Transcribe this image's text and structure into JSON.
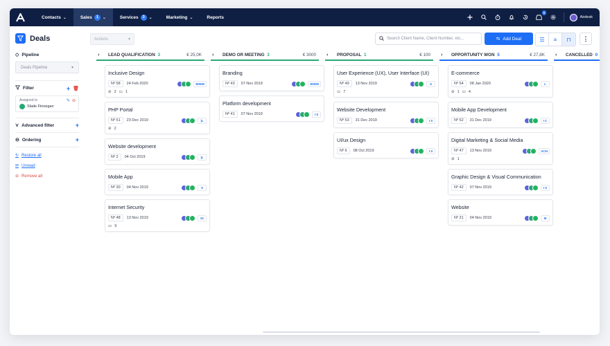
{
  "nav": {
    "items": [
      {
        "label": "Contacts",
        "badge": "",
        "active": false,
        "dropdown": true
      },
      {
        "label": "Sales",
        "badge": "1",
        "active": true,
        "dropdown": true
      },
      {
        "label": "Services",
        "badge": "3",
        "active": false,
        "dropdown": true
      },
      {
        "label": "Marketing",
        "badge": "",
        "active": false,
        "dropdown": true
      },
      {
        "label": "Reports",
        "badge": "",
        "active": false,
        "dropdown": false
      }
    ],
    "right_icons": [
      "plus-icon",
      "search-icon",
      "stopwatch-icon",
      "bell-icon",
      "history-icon",
      "inbox-icon",
      "gear-icon"
    ],
    "inbox_badge": "9",
    "user_name": "Airdesk"
  },
  "sidebar": {
    "title": "Deals",
    "pipeline_label": "Pipeline",
    "pipeline_value": "Deals Pipeline",
    "filter_label": "Filter",
    "assigned_label": "Assigned to",
    "assigned_name": "Slade Finnegan",
    "advanced_filter_label": "Advanced filter",
    "ordering_label": "Ordering",
    "restore_label": "Restore all",
    "unread_label": "Unread",
    "remove_label": "Remove all"
  },
  "toolbar": {
    "actions_label": "Actions",
    "search_placeholder": "Search Client Name, Client Number, etc...",
    "add_deal_label": "Add Deal"
  },
  "columns": [
    {
      "name": "LEAD QUALIFICATION",
      "count": "3",
      "amount": "€ 25,0K",
      "accent": "#2aa876",
      "cards": [
        {
          "title": "Inclusive Design",
          "no": "Nº 58",
          "date": "24 Feb 2020",
          "tag": "WWW",
          "meta": [
            [
              "paperclip",
              "2"
            ],
            [
              "comment",
              "1"
            ]
          ]
        },
        {
          "title": "PHP Portal",
          "no": "Nº 51",
          "date": "23 Dec 2019",
          "tag": "|L",
          "meta": [
            [
              "paperclip",
              "2"
            ]
          ]
        },
        {
          "title": "Website development",
          "no": "Nº 2",
          "date": "04 Oct 2019",
          "tag": "|L",
          "meta": []
        },
        {
          "title": "Mobile App",
          "no": "Nº 30",
          "date": "04 Nov 2019",
          "tag": "S",
          "meta": []
        },
        {
          "title": "Internet Security",
          "no": "Nº 48",
          "date": "13 Nov 2019",
          "tag": "DI",
          "meta": [
            [
              "comment",
              "9"
            ]
          ]
        }
      ]
    },
    {
      "name": "DEMO OR MEETING",
      "count": "3",
      "amount": "€ 3000",
      "accent": "#2aa876",
      "cards": [
        {
          "title": "Branding",
          "no": "Nº 43",
          "date": "07 Nov 2019",
          "tag": "WWW",
          "meta": []
        },
        {
          "title": "Platform development",
          "no": "Nº 41",
          "date": "07 Nov 2019",
          "tag": "I S",
          "meta": []
        }
      ]
    },
    {
      "name": "PROPOSAL",
      "count": "1",
      "amount": "€ 100",
      "accent": "#2aa876",
      "cards": [
        {
          "title": "User Experience (UX), User Interface (UI)",
          "no": "Nº 49",
          "date": "13 Nov 2019",
          "tag": "S",
          "meta": [
            [
              "comment",
              "7"
            ]
          ]
        },
        {
          "title": "Website Development",
          "no": "Nº 53",
          "date": "31 Dec 2019",
          "tag": "I S",
          "meta": []
        },
        {
          "title": "UI/ux Design",
          "no": "Nº 6",
          "date": "08 Oct 2019",
          "tag": "I S",
          "meta": []
        }
      ]
    },
    {
      "name": "OPPORTUNITY WON",
      "count": "5",
      "amount": "€ 27,8K",
      "accent": "#1e6ef5",
      "cards": [
        {
          "title": "E-commerce",
          "no": "Nº 54",
          "date": "08 Jan 2020",
          "tag": "L",
          "meta": [
            [
              "paperclip",
              "1"
            ],
            [
              "comment",
              "4"
            ]
          ]
        },
        {
          "title": "Mobile App Development",
          "no": "Nº 52",
          "date": "31 Dec 2019",
          "tag": "I C",
          "meta": []
        },
        {
          "title": "Digital Marketing & Social Media",
          "no": "Nº 47",
          "date": "13 Nov 2019",
          "tag": "ACH",
          "meta": [
            [
              "paperclip",
              "1"
            ]
          ]
        },
        {
          "title": "Graphic Design & Visual Communication",
          "no": "Nº 42",
          "date": "07 Nov 2019",
          "tag": "I S",
          "meta": []
        },
        {
          "title": "Website",
          "no": "Nº 31",
          "date": "04 Nov 2019",
          "tag": "M",
          "meta": []
        }
      ]
    },
    {
      "name": "CANCELLED",
      "count": "0",
      "amount": "",
      "accent": "#1e6ef5",
      "cards": []
    }
  ]
}
